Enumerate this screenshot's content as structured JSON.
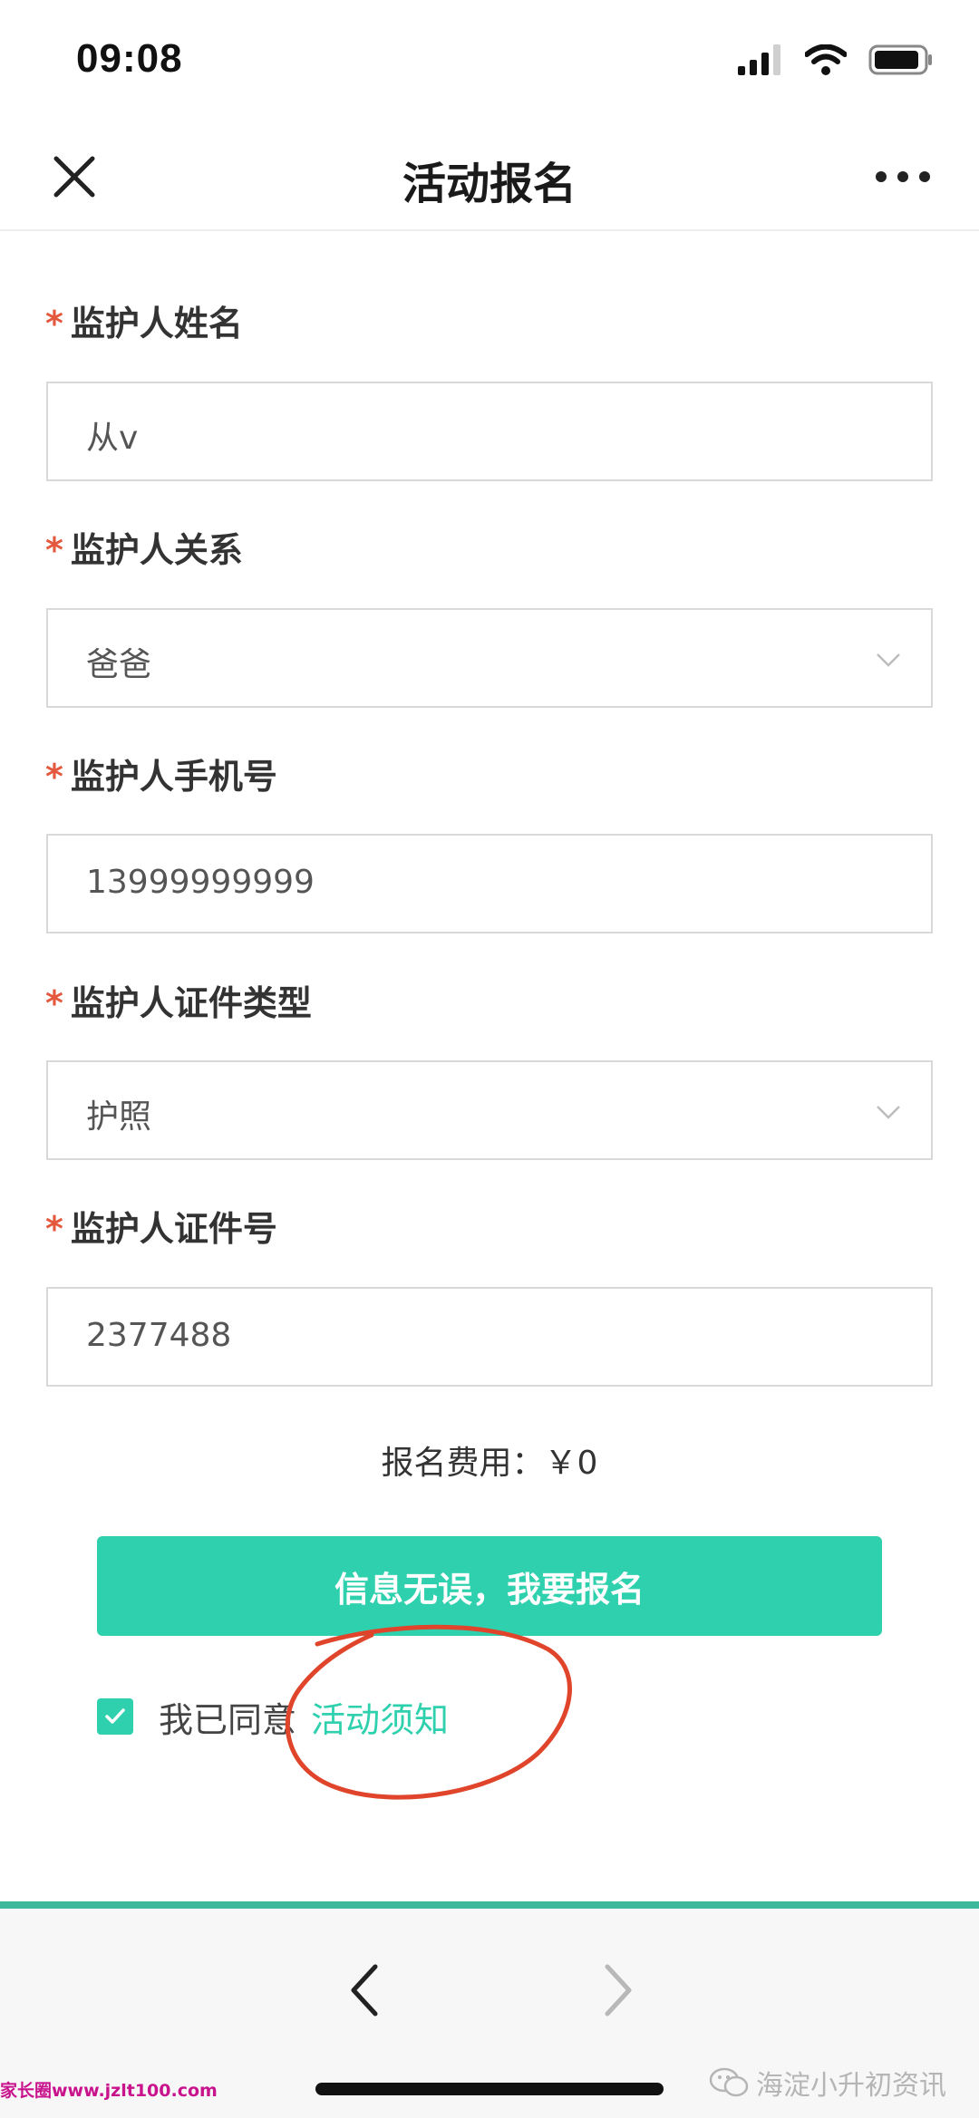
{
  "status_bar": {
    "time": "09:08",
    "icons": [
      "signal-icon",
      "wifi-icon",
      "battery-icon"
    ]
  },
  "nav": {
    "title": "活动报名",
    "close_icon": "close-icon",
    "more_icon": "more-icon"
  },
  "form": {
    "required_mark": "*",
    "fields": [
      {
        "label": "监护人姓名",
        "value": "从v",
        "type": "text"
      },
      {
        "label": "监护人关系",
        "value": "爸爸",
        "type": "select"
      },
      {
        "label": "监护人手机号",
        "value": "13999999999",
        "type": "text"
      },
      {
        "label": "监护人证件类型",
        "value": "护照",
        "type": "select"
      },
      {
        "label": "监护人证件号",
        "value": "2377488",
        "type": "text"
      }
    ],
    "fee_label": "报名费用：",
    "fee_value": "￥0",
    "submit_label": "信息无误，我要报名",
    "agree_checked": true,
    "agree_text": "我已同意",
    "agree_link": "活动须知"
  },
  "toolbar": {
    "back_icon": "chevron-left-icon",
    "forward_icon": "chevron-right-icon"
  },
  "watermarks": {
    "left": "家长圈www.jzlt100.com",
    "right": "海淀小升初资讯"
  },
  "colors": {
    "accent": "#2ed0ae",
    "required": "#e4583e",
    "annotation": "#e0452c",
    "toolbar_line": "#3eb89a"
  }
}
